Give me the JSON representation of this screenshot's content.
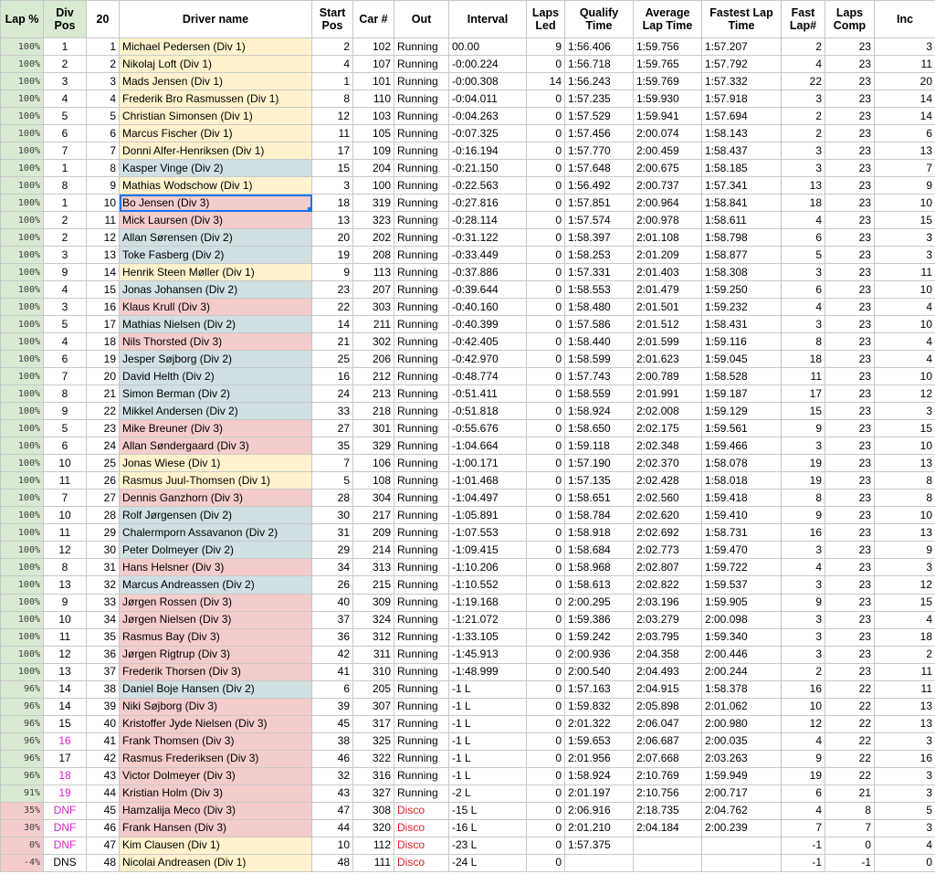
{
  "colors": {
    "lap_bg": "#d9ead3",
    "lap_warn_bg": "#f4cccc",
    "div1": "#fff2cc",
    "div2": "#d0e0e3",
    "div3": "#f4cccc",
    "highlight_text": "#e01ed6",
    "disco_text": "#e02020",
    "selection": "#1a73e8"
  },
  "headers": [
    "Lap %",
    "Div Pos",
    "20",
    "Driver name",
    "Start Pos",
    "Car #",
    "Out",
    "Interval",
    "Laps Led",
    "Qualify Time",
    "Average Lap Time",
    "Fastest Lap Time",
    "Fast Lap#",
    "Laps Comp",
    "Inc"
  ],
  "rows": [
    [
      "100%",
      "1",
      "1",
      "Michael Pedersen (Div 1)",
      "2",
      "102",
      "Running",
      "00.00",
      "9",
      "1:56.406",
      "1:59.756",
      "1:57.207",
      "2",
      "23",
      "3"
    ],
    [
      "100%",
      "2",
      "2",
      "Nikolaj Loft (Div 1)",
      "4",
      "107",
      "Running",
      "-0:00.224",
      "0",
      "1:56.718",
      "1:59.765",
      "1:57.792",
      "4",
      "23",
      "11"
    ],
    [
      "100%",
      "3",
      "3",
      "Mads Jensen (Div 1)",
      "1",
      "101",
      "Running",
      "-0:00.308",
      "14",
      "1:56.243",
      "1:59.769",
      "1:57.332",
      "22",
      "23",
      "20"
    ],
    [
      "100%",
      "4",
      "4",
      "Frederik Bro Rasmussen (Div 1)",
      "8",
      "110",
      "Running",
      "-0:04.011",
      "0",
      "1:57.235",
      "1:59.930",
      "1:57.918",
      "3",
      "23",
      "14"
    ],
    [
      "100%",
      "5",
      "5",
      "Christian Simonsen (Div 1)",
      "12",
      "103",
      "Running",
      "-0:04.263",
      "0",
      "1:57.529",
      "1:59.941",
      "1:57.694",
      "2",
      "23",
      "14"
    ],
    [
      "100%",
      "6",
      "6",
      "Marcus Fischer (Div 1)",
      "11",
      "105",
      "Running",
      "-0:07.325",
      "0",
      "1:57.456",
      "2:00.074",
      "1:58.143",
      "2",
      "23",
      "6"
    ],
    [
      "100%",
      "7",
      "7",
      "Donni Alfer-Henriksen (Div 1)",
      "17",
      "109",
      "Running",
      "-0:16.194",
      "0",
      "1:57.770",
      "2:00.459",
      "1:58.437",
      "3",
      "23",
      "13"
    ],
    [
      "100%",
      "1",
      "8",
      "Kasper Vinge (Div 2)",
      "15",
      "204",
      "Running",
      "-0:21.150",
      "0",
      "1:57.648",
      "2:00.675",
      "1:58.185",
      "3",
      "23",
      "7"
    ],
    [
      "100%",
      "8",
      "9",
      "Mathias Wodschow (Div 1)",
      "3",
      "100",
      "Running",
      "-0:22.563",
      "0",
      "1:56.492",
      "2:00.737",
      "1:57.341",
      "13",
      "23",
      "9"
    ],
    [
      "100%",
      "1",
      "10",
      "Bo Jensen (Div 3)",
      "18",
      "319",
      "Running",
      "-0:27.816",
      "0",
      "1:57.851",
      "2:00.964",
      "1:58.841",
      "18",
      "23",
      "10"
    ],
    [
      "100%",
      "2",
      "11",
      "Mick Laursen (Div 3)",
      "13",
      "323",
      "Running",
      "-0:28.114",
      "0",
      "1:57.574",
      "2:00.978",
      "1:58.611",
      "4",
      "23",
      "15"
    ],
    [
      "100%",
      "2",
      "12",
      "Allan Sørensen (Div 2)",
      "20",
      "202",
      "Running",
      "-0:31.122",
      "0",
      "1:58.397",
      "2:01.108",
      "1:58.798",
      "6",
      "23",
      "3"
    ],
    [
      "100%",
      "3",
      "13",
      "Toke Fasberg (Div 2)",
      "19",
      "208",
      "Running",
      "-0:33.449",
      "0",
      "1:58.253",
      "2:01.209",
      "1:58.877",
      "5",
      "23",
      "3"
    ],
    [
      "100%",
      "9",
      "14",
      "Henrik Steen Møller (Div 1)",
      "9",
      "113",
      "Running",
      "-0:37.886",
      "0",
      "1:57.331",
      "2:01.403",
      "1:58.308",
      "3",
      "23",
      "11"
    ],
    [
      "100%",
      "4",
      "15",
      "Jonas Johansen (Div 2)",
      "23",
      "207",
      "Running",
      "-0:39.644",
      "0",
      "1:58.553",
      "2:01.479",
      "1:59.250",
      "6",
      "23",
      "10"
    ],
    [
      "100%",
      "3",
      "16",
      "Klaus Krull (Div 3)",
      "22",
      "303",
      "Running",
      "-0:40.160",
      "0",
      "1:58.480",
      "2:01.501",
      "1:59.232",
      "4",
      "23",
      "4"
    ],
    [
      "100%",
      "5",
      "17",
      "Mathias Nielsen (Div 2)",
      "14",
      "211",
      "Running",
      "-0:40.399",
      "0",
      "1:57.586",
      "2:01.512",
      "1:58.431",
      "3",
      "23",
      "10"
    ],
    [
      "100%",
      "4",
      "18",
      "Nils Thorsted (Div 3)",
      "21",
      "302",
      "Running",
      "-0:42.405",
      "0",
      "1:58.440",
      "2:01.599",
      "1:59.116",
      "8",
      "23",
      "4"
    ],
    [
      "100%",
      "6",
      "19",
      "Jesper Søjborg (Div 2)",
      "25",
      "206",
      "Running",
      "-0:42.970",
      "0",
      "1:58.599",
      "2:01.623",
      "1:59.045",
      "18",
      "23",
      "4"
    ],
    [
      "100%",
      "7",
      "20",
      "David Helth (Div 2)",
      "16",
      "212",
      "Running",
      "-0:48.774",
      "0",
      "1:57.743",
      "2:00.789",
      "1:58.528",
      "11",
      "23",
      "10"
    ],
    [
      "100%",
      "8",
      "21",
      "Simon Berman (Div 2)",
      "24",
      "213",
      "Running",
      "-0:51.411",
      "0",
      "1:58.559",
      "2:01.991",
      "1:59.187",
      "17",
      "23",
      "12"
    ],
    [
      "100%",
      "9",
      "22",
      "Mikkel Andersen (Div 2)",
      "33",
      "218",
      "Running",
      "-0:51.818",
      "0",
      "1:58.924",
      "2:02.008",
      "1:59.129",
      "15",
      "23",
      "3"
    ],
    [
      "100%",
      "5",
      "23",
      "Mike Breuner (Div 3)",
      "27",
      "301",
      "Running",
      "-0:55.676",
      "0",
      "1:58.650",
      "2:02.175",
      "1:59.561",
      "9",
      "23",
      "15"
    ],
    [
      "100%",
      "6",
      "24",
      "Allan Søndergaard (Div 3)",
      "35",
      "329",
      "Running",
      "-1:04.664",
      "0",
      "1:59.118",
      "2:02.348",
      "1:59.466",
      "3",
      "23",
      "10"
    ],
    [
      "100%",
      "10",
      "25",
      "Jonas Wiese (Div 1)",
      "7",
      "106",
      "Running",
      "-1:00.171",
      "0",
      "1:57.190",
      "2:02.370",
      "1:58.078",
      "19",
      "23",
      "13"
    ],
    [
      "100%",
      "11",
      "26",
      "Rasmus Juul-Thomsen (Div 1)",
      "5",
      "108",
      "Running",
      "-1:01.468",
      "0",
      "1:57.135",
      "2:02.428",
      "1:58.018",
      "19",
      "23",
      "8"
    ],
    [
      "100%",
      "7",
      "27",
      "Dennis Ganzhorn (Div 3)",
      "28",
      "304",
      "Running",
      "-1:04.497",
      "0",
      "1:58.651",
      "2:02.560",
      "1:59.418",
      "8",
      "23",
      "8"
    ],
    [
      "100%",
      "10",
      "28",
      "Rolf Jørgensen (Div 2)",
      "30",
      "217",
      "Running",
      "-1:05.891",
      "0",
      "1:58.784",
      "2:02.620",
      "1:59.410",
      "9",
      "23",
      "10"
    ],
    [
      "100%",
      "11",
      "29",
      "Chalermporn Assavanon (Div 2)",
      "31",
      "209",
      "Running",
      "-1:07.553",
      "0",
      "1:58.918",
      "2:02.692",
      "1:58.731",
      "16",
      "23",
      "13"
    ],
    [
      "100%",
      "12",
      "30",
      "Peter Dolmeyer (Div 2)",
      "29",
      "214",
      "Running",
      "-1:09.415",
      "0",
      "1:58.684",
      "2:02.773",
      "1:59.470",
      "3",
      "23",
      "9"
    ],
    [
      "100%",
      "8",
      "31",
      "Hans Helsner (Div 3)",
      "34",
      "313",
      "Running",
      "-1:10.206",
      "0",
      "1:58.968",
      "2:02.807",
      "1:59.722",
      "4",
      "23",
      "3"
    ],
    [
      "100%",
      "13",
      "32",
      "Marcus Andreassen (Div 2)",
      "26",
      "215",
      "Running",
      "-1:10.552",
      "0",
      "1:58.613",
      "2:02.822",
      "1:59.537",
      "3",
      "23",
      "12"
    ],
    [
      "100%",
      "9",
      "33",
      "Jørgen Rossen (Div 3)",
      "40",
      "309",
      "Running",
      "-1:19.168",
      "0",
      "2:00.295",
      "2:03.196",
      "1:59.905",
      "9",
      "23",
      "15"
    ],
    [
      "100%",
      "10",
      "34",
      "Jørgen Nielsen (Div 3)",
      "37",
      "324",
      "Running",
      "-1:21.072",
      "0",
      "1:59.386",
      "2:03.279",
      "2:00.098",
      "3",
      "23",
      "4"
    ],
    [
      "100%",
      "11",
      "35",
      "Rasmus Bay (Div 3)",
      "36",
      "312",
      "Running",
      "-1:33.105",
      "0",
      "1:59.242",
      "2:03.795",
      "1:59.340",
      "3",
      "23",
      "18"
    ],
    [
      "100%",
      "12",
      "36",
      "Jørgen Rigtrup (Div 3)",
      "42",
      "311",
      "Running",
      "-1:45.913",
      "0",
      "2:00.936",
      "2:04.358",
      "2:00.446",
      "3",
      "23",
      "2"
    ],
    [
      "100%",
      "13",
      "37",
      "Frederik Thorsen (Div 3)",
      "41",
      "310",
      "Running",
      "-1:48.999",
      "0",
      "2:00.540",
      "2:04.493",
      "2:00.244",
      "2",
      "23",
      "11"
    ],
    [
      "96%",
      "14",
      "38",
      "Daniel Boje Hansen (Div 2)",
      "6",
      "205",
      "Running",
      "-1 L",
      "0",
      "1:57.163",
      "2:04.915",
      "1:58.378",
      "16",
      "22",
      "11"
    ],
    [
      "96%",
      "14",
      "39",
      "Niki Søjborg (Div 3)",
      "39",
      "307",
      "Running",
      "-1 L",
      "0",
      "1:59.832",
      "2:05.898",
      "2:01.062",
      "10",
      "22",
      "13"
    ],
    [
      "96%",
      "15",
      "40",
      "Kristoffer Jyde Nielsen (Div 3)",
      "45",
      "317",
      "Running",
      "-1 L",
      "0",
      "2:01.322",
      "2:06.047",
      "2:00.980",
      "12",
      "22",
      "13"
    ],
    [
      "96%",
      "16",
      "41",
      "Frank Thomsen (Div 3)",
      "38",
      "325",
      "Running",
      "-1 L",
      "0",
      "1:59.653",
      "2:06.687",
      "2:00.035",
      "4",
      "22",
      "3"
    ],
    [
      "96%",
      "17",
      "42",
      "Rasmus Frederiksen (Div 3)",
      "46",
      "322",
      "Running",
      "-1 L",
      "0",
      "2:01.956",
      "2:07.668",
      "2:03.263",
      "9",
      "22",
      "16"
    ],
    [
      "96%",
      "18",
      "43",
      "Victor Dolmeyer (Div 3)",
      "32",
      "316",
      "Running",
      "-1 L",
      "0",
      "1:58.924",
      "2:10.769",
      "1:59.949",
      "19",
      "22",
      "3"
    ],
    [
      "91%",
      "19",
      "44",
      "Kristian Holm (Div 3)",
      "43",
      "327",
      "Running",
      "-2 L",
      "0",
      "2:01.197",
      "2:10.756",
      "2:00.717",
      "6",
      "21",
      "3"
    ],
    [
      "35%",
      "DNF",
      "45",
      "Hamzalija Meco (Div 3)",
      "47",
      "308",
      "Disco",
      "-15 L",
      "0",
      "2:06.916",
      "2:18.735",
      "2:04.762",
      "4",
      "8",
      "5"
    ],
    [
      "30%",
      "DNF",
      "46",
      "Frank Hansen (Div 3)",
      "44",
      "320",
      "Disco",
      "-16 L",
      "0",
      "2:01.210",
      "2:04.184",
      "2:00.239",
      "7",
      "7",
      "3"
    ],
    [
      "0%",
      "DNF",
      "47",
      "Kim Clausen (Div 1)",
      "10",
      "112",
      "Disco",
      "-23 L",
      "0",
      "1:57.375",
      "",
      "",
      "-1",
      "0",
      "4"
    ],
    [
      "-4%",
      "DNS",
      "48",
      "Nicolai Andreasen (Div 1)",
      "48",
      "111",
      "Disco",
      "-24 L",
      "0",
      "",
      "",
      "",
      "-1",
      "-1",
      "0"
    ]
  ]
}
